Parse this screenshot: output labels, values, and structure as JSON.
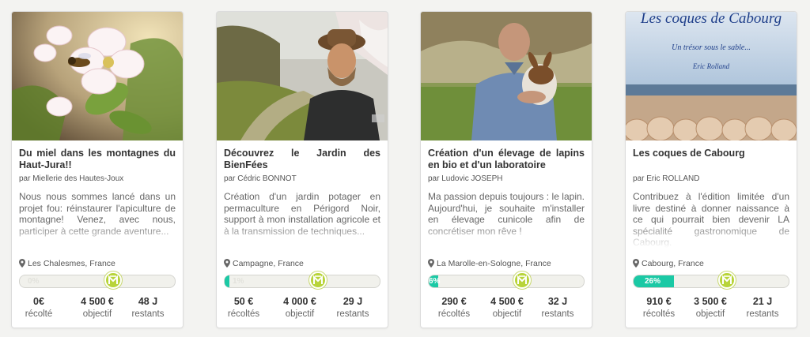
{
  "projects": [
    {
      "title": "Du miel dans les montagnes du Haut-Jura!!",
      "author": "par Miellerie des Hautes-Joux",
      "description": "Nous nous sommes lancé dans un projet fou: réinstaurer l'apiculture de montagne! Venez, avec nous, participer à cette grande aventure...",
      "location": "Les Chalesmes, France",
      "progress_label": "0%",
      "progress_fraction": 0.0,
      "milestone_fraction": 0.6,
      "stats": [
        {
          "value": "0€",
          "label": "récolté"
        },
        {
          "value": "4 500 €",
          "label": "objectif"
        },
        {
          "value": "48 J",
          "label": "restants"
        }
      ]
    },
    {
      "title": "Découvrez le Jardin des BienFées",
      "author": "par Cédric BONNOT",
      "description": "Création d'un jardin potager en permaculture en Périgord Noir, support à mon installation agricole et à la transmission de techniques...",
      "location": "Campagne, France",
      "progress_label": "1%",
      "progress_fraction": 0.01,
      "milestone_fraction": 0.6,
      "stats": [
        {
          "value": "50 €",
          "label": "récoltés"
        },
        {
          "value": "4 000 €",
          "label": "objectif"
        },
        {
          "value": "29 J",
          "label": "restants"
        }
      ]
    },
    {
      "title": "Création d'un élevage de lapins en bio et d'un laboratoire",
      "author": "par Ludovic JOSEPH",
      "description": "Ma passion depuis toujours : le lapin. Aujourd'hui, je souhaite m'installer en élevage cunicole afin de concrétiser mon rêve !",
      "location": "La Marolle-en-Sologne, France",
      "progress_label": "6%",
      "progress_fraction": 0.06,
      "milestone_fraction": 0.6,
      "stats": [
        {
          "value": "290 €",
          "label": "récoltés"
        },
        {
          "value": "4 500 €",
          "label": "objectif"
        },
        {
          "value": "32 J",
          "label": "restants"
        }
      ]
    },
    {
      "title": "Les coques de Cabourg",
      "author": "par Eric ROLLAND",
      "description": "Contribuez à l'édition limitée d'un livre destiné à donner naissance à ce qui pourrait bien devenir LA spécialité gastronomique de Cabourg.",
      "location": "Cabourg, France",
      "progress_label": "26%",
      "progress_fraction": 0.26,
      "milestone_fraction": 0.6,
      "image_caption": {
        "title": "Les coques de Cabourg",
        "subtitle": "Un trésor sous le sable...",
        "author": "Eric Rolland"
      },
      "stats": [
        {
          "value": "910 €",
          "label": "récoltés"
        },
        {
          "value": "3 500 €",
          "label": "objectif"
        },
        {
          "value": "21 J",
          "label": "restants"
        }
      ]
    }
  ],
  "colors": {
    "progress_fill": "#1bc9a5",
    "milestone_badge": "#b8d43a",
    "page_background": "#f3f3f1"
  },
  "icons": {
    "location": "map-pin-icon",
    "milestone": "miimosa-m-icon"
  }
}
